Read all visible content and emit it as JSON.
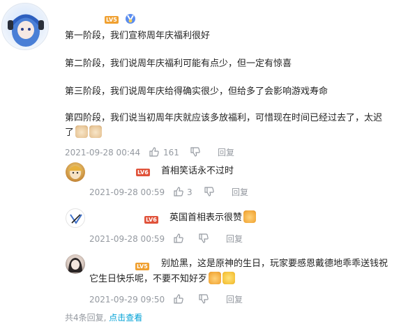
{
  "main_comment": {
    "level": "LV5",
    "lines": [
      "第一阶段，我们宣称周年庆福利很好",
      "第二阶段，我们说周年庆福利可能有点少，但一定有惊喜",
      "第三阶段，我们说周年庆给得确实很少，但给多了会影响游戏寿命",
      "第四阶段，我们说当初周年庆就应该多放福利，可惜现在时间已经过去了，太迟",
      "了"
    ],
    "time": "2021-09-28 00:44",
    "likes": "161",
    "reply_label": "回复"
  },
  "replies": [
    {
      "level": "LV6",
      "text": "首相笑话永不过时",
      "time": "2021-09-28 00:59",
      "likes": "3",
      "reply_label": "回复"
    },
    {
      "level": "LV6",
      "text": "英国首相表示很赞",
      "time": "2021-09-28 00:59",
      "likes": "",
      "reply_label": "回复"
    },
    {
      "level": "LV5",
      "text_line1": "别尬黑，这是原神的生日，玩家要感恩戴德地乖乖送钱祝",
      "text_line2": "它生日快乐呢，不要不知好歹",
      "time": "2021-09-29 09:50",
      "likes": "",
      "reply_label": "回复"
    }
  ],
  "footer": {
    "total": "共4条回复,",
    "view_link": "点击查看"
  },
  "colors": {
    "meta_gray": "#9499a0",
    "link_blue": "#00a1d6",
    "level_orange": "#f0a030",
    "level_red": "#e0523a"
  }
}
